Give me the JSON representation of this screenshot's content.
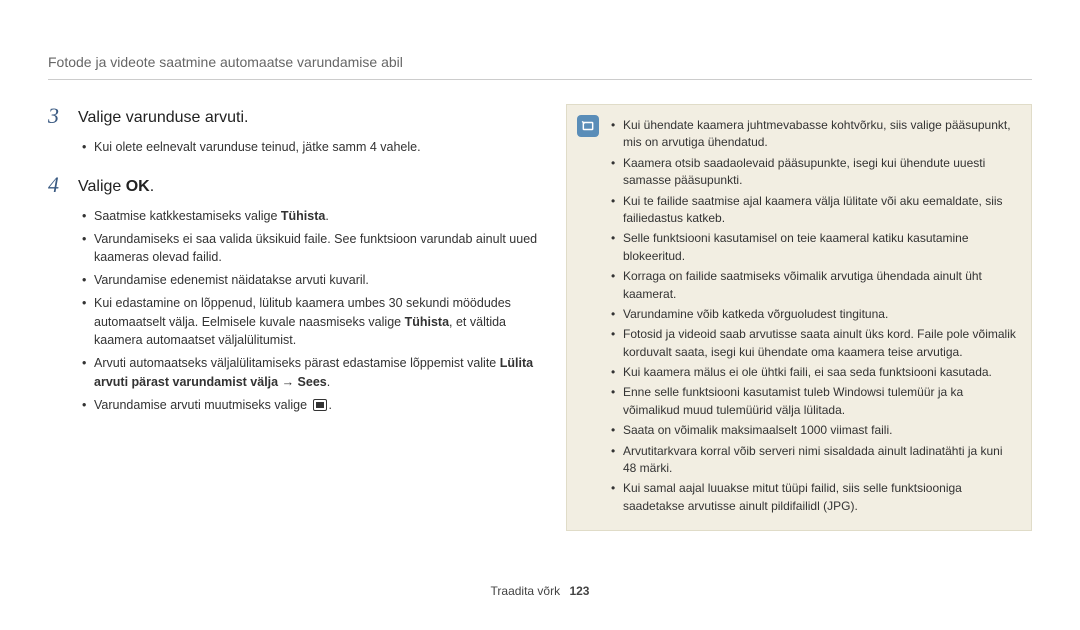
{
  "header": {
    "title": "Fotode ja videote saatmine automaatse varundamise abil"
  },
  "steps": [
    {
      "num": "3",
      "text": "Valige varunduse arvuti.",
      "bullets": [
        {
          "pre": "Kui olete eelnevalt varunduse teinud, jätke samm 4 vahele."
        }
      ]
    },
    {
      "num": "4",
      "text_pre": "Valige ",
      "text_bold": "OK",
      "text_post": ".",
      "bullets": [
        {
          "pre": "Saatmise katkkestamiseks valige ",
          "bold": "Tühista",
          "post": "."
        },
        {
          "pre": "Varundamiseks ei saa valida üksikuid faile. See funktsioon varundab ainult uued kaameras olevad failid."
        },
        {
          "pre": "Varundamise edenemist näidatakse arvuti kuvaril."
        },
        {
          "pre": "Kui edastamine on lõppenud, lülitub kaamera umbes 30 sekundi möödudes automaatselt välja. Eelmisele kuvale naasmiseks valige ",
          "bold": "Tühista",
          "post": ", et vältida kaamera automaatset väljalülitumist."
        },
        {
          "pre": "Arvuti automaatseks väljalülitamiseks pärast edastamise lõppemist valite ",
          "boldline": "Lülita arvuti pärast varundamist välja → Sees",
          "post": "."
        },
        {
          "pre": "Varundamise arvuti muutmiseks valige ",
          "icon": true,
          "post": "."
        }
      ]
    }
  ],
  "info": [
    "Kui ühendate kaamera juhtmevabasse kohtvõrku, siis valige pääsupunkt, mis on arvutiga ühendatud.",
    "Kaamera otsib saadaolevaid pääsupunkte, isegi kui ühendute uuesti samasse pääsupunkti.",
    "Kui te failide saatmise ajal kaamera välja lülitate või aku eemaldate, siis failiedastus katkeb.",
    "Selle funktsiooni kasutamisel on teie kaameral katiku kasutamine blokeeritud.",
    "Korraga on failide saatmiseks võimalik arvutiga ühendada ainult üht kaamerat.",
    "Varundamine võib katkeda võrguoludest tingituna.",
    "Fotosid ja videoid saab arvutisse saata ainult üks kord. Faile pole võimalik korduvalt saata, isegi kui ühendate oma kaamera teise arvutiga.",
    "Kui kaamera mälus ei ole ühtki faili, ei saa seda funktsiooni kasutada.",
    "Enne selle funktsiooni kasutamist tuleb Windowsi tulemüür ja ka võimalikud muud tulemüürid välja lülitada.",
    "Saata on võimalik maksimaalselt 1000 viimast faili.",
    "Arvutitarkvara korral võib serveri nimi sisaldada ainult ladinatähti ja kuni 48 märki.",
    "Kui samal aajal luuakse mitut tüüpi failid, siis selle funktsiooniga saadetakse arvutisse ainult pildifailidl (JPG)."
  ],
  "footer": {
    "section": "Traadita võrk",
    "page": "123"
  }
}
